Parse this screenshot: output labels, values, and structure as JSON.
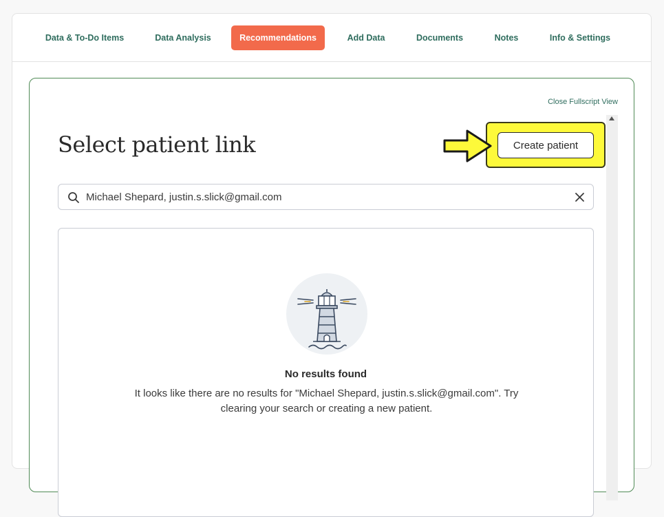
{
  "tabs": [
    {
      "label": "Data & To-Do Items",
      "active": false
    },
    {
      "label": "Data Analysis",
      "active": false
    },
    {
      "label": "Recommendations",
      "active": true
    },
    {
      "label": "Add Data",
      "active": false
    },
    {
      "label": "Documents",
      "active": false
    },
    {
      "label": "Notes",
      "active": false
    },
    {
      "label": "Info & Settings",
      "active": false
    }
  ],
  "panel": {
    "close_link": "Close Fullscript View",
    "title": "Select patient link",
    "create_button": "Create patient"
  },
  "search": {
    "value": "Michael Shepard, justin.s.slick@gmail.com",
    "icon": "search-icon",
    "clear_icon": "close-icon"
  },
  "empty_state": {
    "illustration": "lighthouse-icon",
    "title": "No results found",
    "message_line1": "It looks like there are no results for \"Michael Shepard, justin.s.slick@gmail.com\". Try",
    "message_line2": "clearing your search or creating a new patient."
  },
  "colors": {
    "accent": "#f26a4b",
    "tab_text": "#2f6d5e",
    "panel_border": "#4f8a55",
    "highlight": "#fdf93a"
  }
}
